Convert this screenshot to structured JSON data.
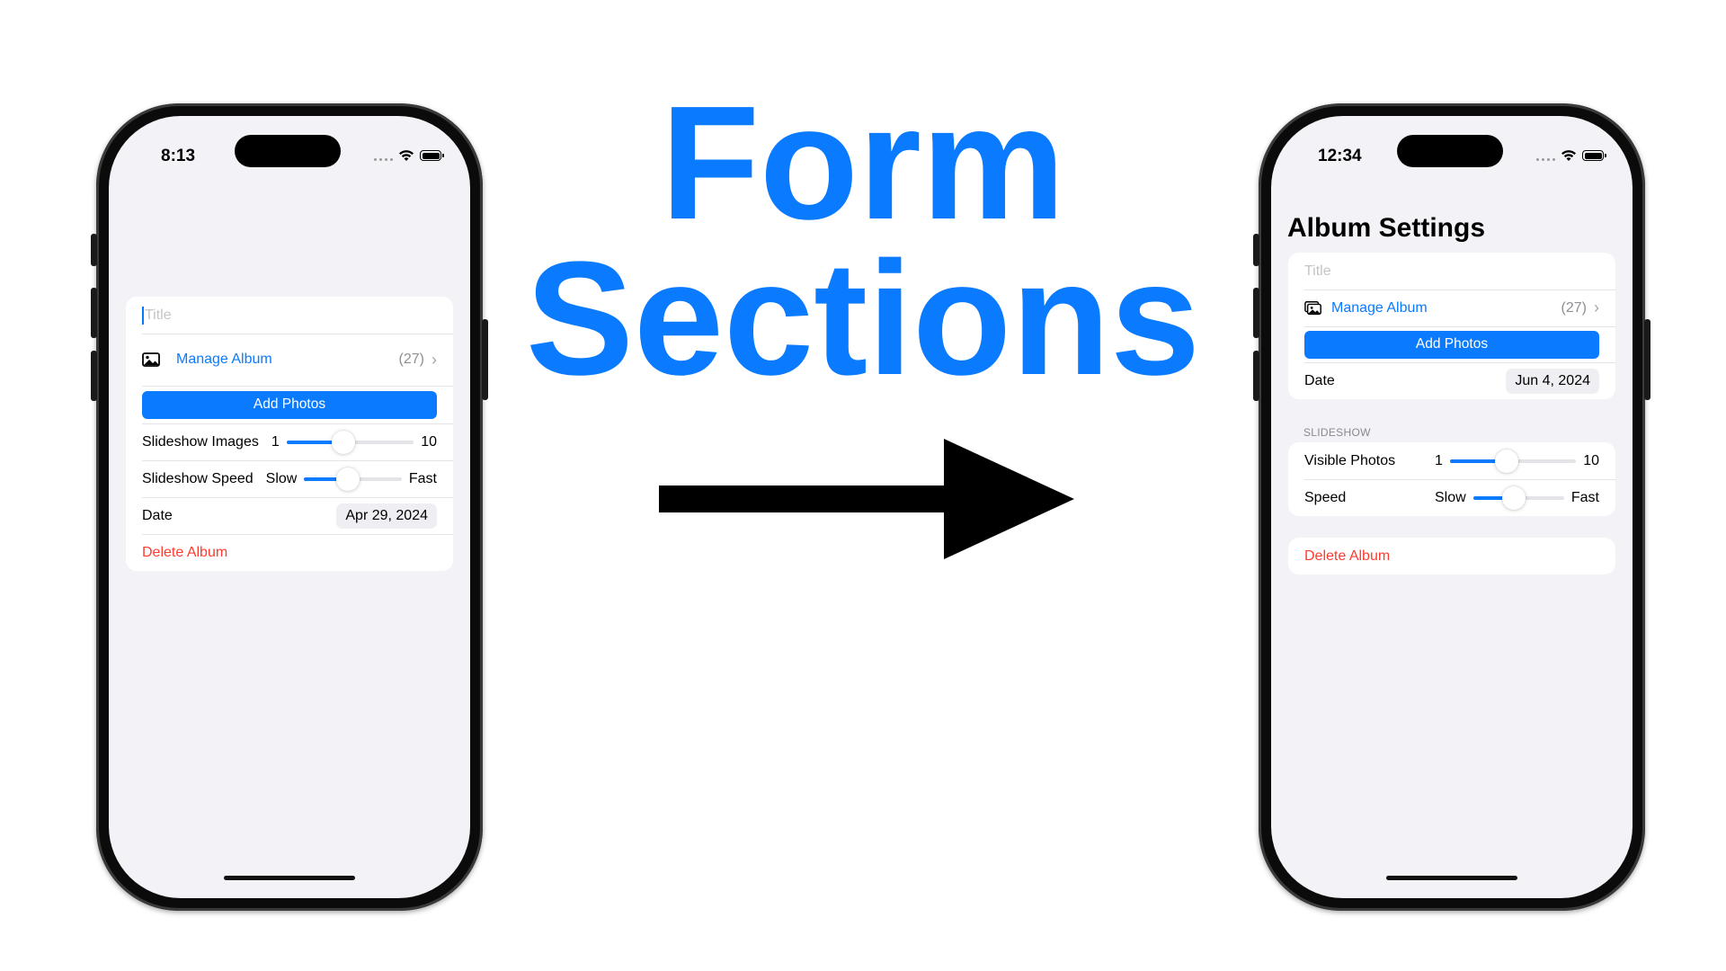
{
  "heading": {
    "line1": "Form",
    "line2": "Sections"
  },
  "colors": {
    "accent": "#0a7aff",
    "destructive": "#ff3b30",
    "arrow": "#000000"
  },
  "before": {
    "status_time": "8:13",
    "title_placeholder": "Title",
    "manage_album": {
      "icon": "photo-icon",
      "label": "Manage Album",
      "count": "(27)"
    },
    "add_photos": "Add Photos",
    "slideshow_images": {
      "label": "Slideshow Images",
      "min": "1",
      "max": "10",
      "value_fraction": 0.45
    },
    "slideshow_speed": {
      "label": "Slideshow Speed",
      "min": "Slow",
      "max": "Fast",
      "value_fraction": 0.45
    },
    "date": {
      "label": "Date",
      "value": "Apr 29, 2024"
    },
    "delete": "Delete Album"
  },
  "after": {
    "status_time": "12:34",
    "nav_title": "Album Settings",
    "title_placeholder": "Title",
    "manage_album": {
      "icon": "photo-stack-icon",
      "label": "Manage Album",
      "count": "(27)"
    },
    "add_photos": "Add Photos",
    "date": {
      "label": "Date",
      "value": "Jun 4, 2024"
    },
    "slideshow_header": "SLIDESHOW",
    "visible_photos": {
      "label": "Visible Photos",
      "min": "1",
      "max": "10",
      "value_fraction": 0.45
    },
    "speed": {
      "label": "Speed",
      "min": "Slow",
      "max": "Fast",
      "value_fraction": 0.45
    },
    "delete": "Delete Album"
  }
}
